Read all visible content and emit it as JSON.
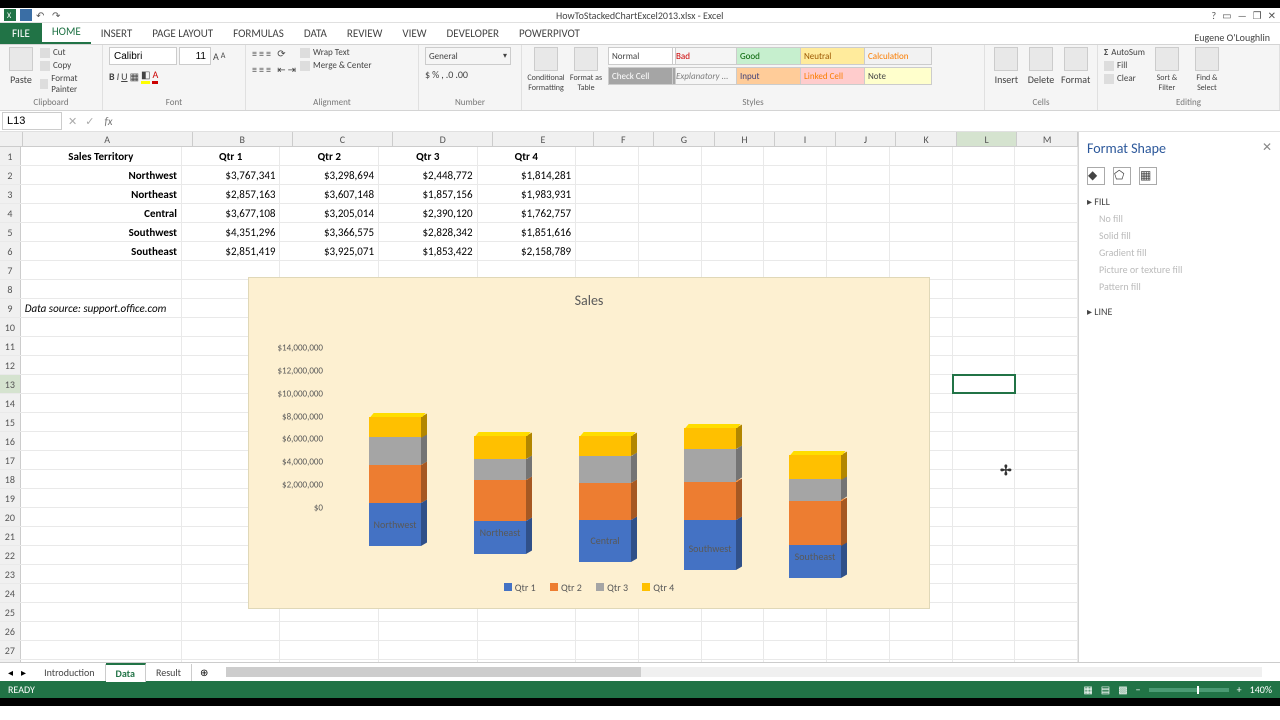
{
  "title_bar": {
    "filename": "HowToStackedChartExcel2013.xlsx - Excel",
    "user": "Eugene O'Loughlin"
  },
  "tabs": {
    "file": "FILE",
    "items": [
      "HOME",
      "INSERT",
      "PAGE LAYOUT",
      "FORMULAS",
      "DATA",
      "REVIEW",
      "VIEW",
      "DEVELOPER",
      "POWERPIVOT"
    ],
    "active": 0
  },
  "ribbon": {
    "clipboard": {
      "label": "Clipboard",
      "paste": "Paste",
      "cut": "Cut",
      "copy": "Copy",
      "painter": "Format Painter"
    },
    "font": {
      "label": "Font",
      "name": "Calibri",
      "size": "11"
    },
    "alignment": {
      "label": "Alignment",
      "wrap": "Wrap Text",
      "merge": "Merge & Center"
    },
    "number": {
      "label": "Number",
      "format": "General"
    },
    "styles": {
      "label": "Styles",
      "cond": "Conditional Formatting",
      "fat": "Format as Table",
      "cells": [
        "Normal",
        "Bad",
        "Good",
        "Neutral",
        "Calculation",
        "Check Cell",
        "Explanatory ...",
        "Input",
        "Linked Cell",
        "Note"
      ]
    },
    "cells": {
      "label": "Cells",
      "insert": "Insert",
      "delete": "Delete",
      "format": "Format"
    },
    "editing": {
      "label": "Editing",
      "sum": "AutoSum",
      "fill": "Fill",
      "clear": "Clear",
      "sort": "Sort & Filter",
      "find": "Find & Select"
    }
  },
  "namebox": "L13",
  "columns": [
    "A",
    "B",
    "C",
    "D",
    "E",
    "F",
    "G",
    "H",
    "I",
    "J",
    "K",
    "L",
    "M"
  ],
  "selected_col": "L",
  "selected_row": 13,
  "table": {
    "headers": [
      "Sales Territory",
      "Qtr 1",
      "Qtr 2",
      "Qtr 3",
      "Qtr 4"
    ],
    "rows": [
      {
        "t": "Northwest",
        "q": [
          "$3,767,341",
          "$3,298,694",
          "$2,448,772",
          "$1,814,281"
        ]
      },
      {
        "t": "Northeast",
        "q": [
          "$2,857,163",
          "$3,607,148",
          "$1,857,156",
          "$1,983,931"
        ]
      },
      {
        "t": "Central",
        "q": [
          "$3,677,108",
          "$3,205,014",
          "$2,390,120",
          "$1,762,757"
        ]
      },
      {
        "t": "Southwest",
        "q": [
          "$4,351,296",
          "$3,366,575",
          "$2,828,342",
          "$1,851,616"
        ]
      },
      {
        "t": "Southeast",
        "q": [
          "$2,851,419",
          "$3,925,071",
          "$1,853,422",
          "$2,158,789"
        ]
      }
    ],
    "source": "Data source: support.office.com"
  },
  "chart_data": {
    "type": "bar",
    "stacked": true,
    "3d": true,
    "title": "Sales",
    "categories": [
      "Northwest",
      "Northeast",
      "Central",
      "Southwest",
      "Southeast"
    ],
    "series": [
      {
        "name": "Qtr 1",
        "values": [
          3767341,
          2857163,
          3677108,
          4351296,
          2851419
        ],
        "color": "#4472c4"
      },
      {
        "name": "Qtr 2",
        "values": [
          3298694,
          3607148,
          3205014,
          3366575,
          3925071
        ],
        "color": "#ed7d31"
      },
      {
        "name": "Qtr 3",
        "values": [
          2448772,
          1857156,
          2390120,
          2828342,
          1853422
        ],
        "color": "#a5a5a5"
      },
      {
        "name": "Qtr 4",
        "values": [
          1814281,
          1983931,
          1762757,
          1851616,
          2158789
        ],
        "color": "#ffc000"
      }
    ],
    "ylabel": "",
    "xlabel": "",
    "ylim": [
      0,
      14000000
    ],
    "yticks": [
      "$0",
      "$2,000,000",
      "$4,000,000",
      "$6,000,000",
      "$8,000,000",
      "$10,000,000",
      "$12,000,000",
      "$14,000,000"
    ]
  },
  "format_pane": {
    "title": "Format Shape",
    "fill": "FILL",
    "fill_opts": [
      "No fill",
      "Solid fill",
      "Gradient fill",
      "Picture or texture fill",
      "Pattern fill"
    ],
    "line": "LINE"
  },
  "sheet_tabs": {
    "items": [
      "Introduction",
      "Data",
      "Result"
    ],
    "active": 1
  },
  "status": {
    "ready": "READY",
    "zoom": "140%"
  }
}
